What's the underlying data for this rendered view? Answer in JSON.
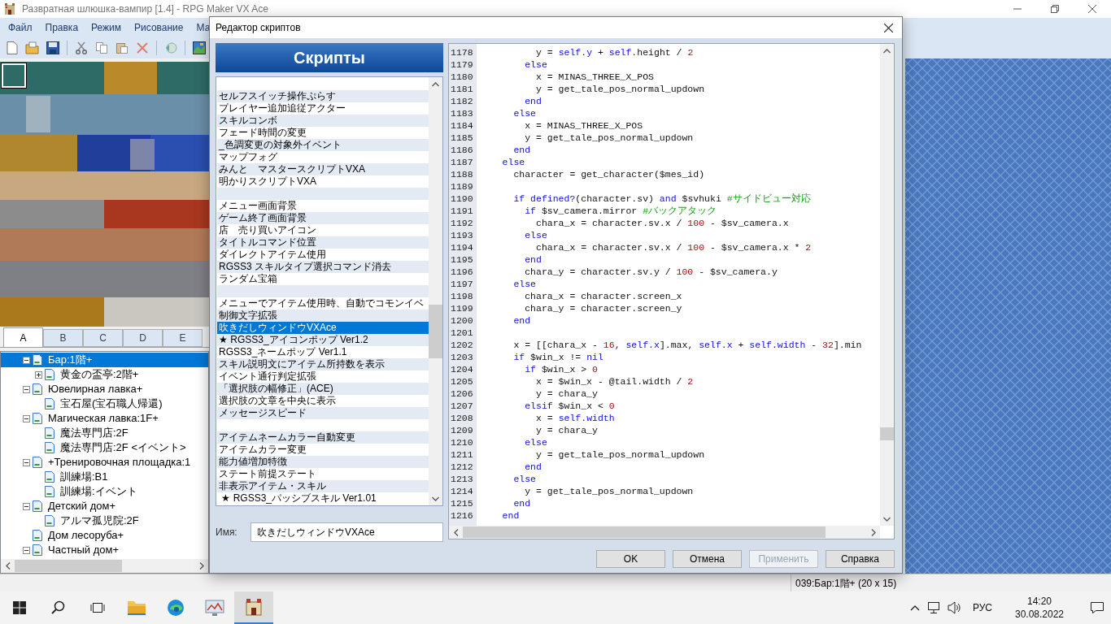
{
  "app": {
    "title": "Развратная шлюшка-вампир [1.4] - RPG Maker VX Ace"
  },
  "menu": [
    "Файл",
    "Правка",
    "Режим",
    "Рисование",
    "Ма"
  ],
  "tileset_tabs": [
    {
      "label": "A",
      "selected": true
    },
    {
      "label": "B",
      "selected": false
    },
    {
      "label": "C",
      "selected": false
    },
    {
      "label": "D",
      "selected": false
    },
    {
      "label": "E",
      "selected": false
    }
  ],
  "map_tree": [
    {
      "label": "Бар:1階+",
      "selected": true,
      "expanded": true,
      "children": [
        {
          "label": "黄金の盃亭:2階+",
          "selected": false,
          "expanded": false
        }
      ]
    },
    {
      "label": "Ювелирная лавка+",
      "selected": false,
      "expanded": true,
      "children": [
        {
          "label": "宝石屋(宝石職人帰還)",
          "selected": false
        }
      ]
    },
    {
      "label": "Магическая лавка:1F+",
      "selected": false,
      "expanded": true,
      "children": [
        {
          "label": "魔法専門店:2F",
          "selected": false
        },
        {
          "label": "魔法専門店:2F <イベント>",
          "selected": false
        }
      ]
    },
    {
      "label": "+Тренировочная площадка:1",
      "selected": false,
      "expanded": true,
      "children": [
        {
          "label": "訓練場:B1",
          "selected": false
        },
        {
          "label": "訓練場:イベント",
          "selected": false
        }
      ]
    },
    {
      "label": "Детский дом+",
      "selected": false,
      "expanded": true,
      "children": [
        {
          "label": "アルマ孤児院:2F",
          "selected": false
        }
      ]
    },
    {
      "label": "Дом лесоруба+",
      "selected": false
    },
    {
      "label": "Частный дом+",
      "selected": false,
      "expanded": true
    }
  ],
  "status_bar": {
    "map_info": "039:Бар:1階+ (20 x 15)"
  },
  "script_editor": {
    "title": "Редактор скриптов",
    "header": "Скрипты",
    "scripts": [
      {
        "kind": "blank",
        "selected": false
      },
      {
        "kind": "script",
        "label": "セルフスイッチ操作ぷらす",
        "selected": false
      },
      {
        "kind": "script",
        "label": "プレイヤー追加追従アクター",
        "selected": false
      },
      {
        "kind": "script",
        "label": "スキルコンボ",
        "selected": false
      },
      {
        "kind": "script",
        "label": "フェード時間の変更",
        "selected": false
      },
      {
        "kind": "script",
        "label": "_色調変更の対象外イベント",
        "selected": false
      },
      {
        "kind": "script",
        "label": "マップフォグ",
        "selected": false
      },
      {
        "kind": "script",
        "label": "みんと　マスタースクリプトVXA",
        "selected": false
      },
      {
        "kind": "script",
        "label": "明かりスクリプトVXA",
        "selected": false
      },
      {
        "kind": "blank",
        "selected": false
      },
      {
        "kind": "script",
        "label": "メニュー画面背景",
        "selected": false
      },
      {
        "kind": "script",
        "label": "ゲーム終了画面背景",
        "selected": false
      },
      {
        "kind": "script",
        "label": "店　売り買いアイコン",
        "selected": false
      },
      {
        "kind": "script",
        "label": "タイトルコマンド位置",
        "selected": false
      },
      {
        "kind": "script",
        "label": "ダイレクトアイテム使用",
        "selected": false
      },
      {
        "kind": "script",
        "label": "RGSS3 スキルタイプ選択コマンド消去",
        "selected": false
      },
      {
        "kind": "script",
        "label": "ランダム宝箱",
        "selected": false
      },
      {
        "kind": "blank",
        "selected": false
      },
      {
        "kind": "script",
        "label": "メニューでアイテム使用時、自動でコモンイベ",
        "selected": false
      },
      {
        "kind": "script",
        "label": "制御文字拡張",
        "selected": false
      },
      {
        "kind": "script",
        "label": "吹きだしウィンドウVXAce",
        "selected": true
      },
      {
        "kind": "script",
        "label": "★ RGSS3_アイコンポップ Ver1.2",
        "selected": false
      },
      {
        "kind": "script",
        "label": "RGSS3_ネームポップ Ver1.1",
        "selected": false
      },
      {
        "kind": "script",
        "label": "スキル説明文にアイテム所持数を表示",
        "selected": false
      },
      {
        "kind": "script",
        "label": "イベント通行判定拡張",
        "selected": false
      },
      {
        "kind": "script",
        "label": "「選択肢の幅修正」(ACE)",
        "selected": false
      },
      {
        "kind": "script",
        "label": "選択肢の文章を中央に表示",
        "selected": false
      },
      {
        "kind": "script",
        "label": "メッセージスピード",
        "selected": false
      },
      {
        "kind": "blank",
        "selected": false
      },
      {
        "kind": "script",
        "label": "アイテムネームカラー自動変更",
        "selected": false
      },
      {
        "kind": "script",
        "label": "アイテムカラー変更",
        "selected": false
      },
      {
        "kind": "script",
        "label": "能力値増加特徴",
        "selected": false
      },
      {
        "kind": "script",
        "label": "ステート前提ステート",
        "selected": false
      },
      {
        "kind": "script",
        "label": "非表示アイテム・スキル",
        "selected": false
      },
      {
        "kind": "script",
        "label": " ★ RGSS3_パッシブスキル Ver1.01",
        "selected": false
      }
    ],
    "name_label": "Имя:",
    "name_value": "吹きだしウィンドウVXAce",
    "code_lines": [
      {
        "number": "1178",
        "segments": [
          {
            "kind": "plain",
            "text": "          y = "
          },
          {
            "kind": "keyword",
            "text": "self.y"
          },
          {
            "kind": "plain",
            "text": " + "
          },
          {
            "kind": "keyword",
            "text": "self."
          },
          {
            "kind": "plain",
            "text": "height / "
          },
          {
            "kind": "number",
            "text": "2"
          }
        ]
      },
      {
        "number": "1179",
        "segments": [
          {
            "kind": "keyword",
            "text": "        else"
          }
        ]
      },
      {
        "number": "1180",
        "segments": [
          {
            "kind": "plain",
            "text": "          x = MINAS_THREE_X_POS"
          }
        ]
      },
      {
        "number": "1181",
        "segments": [
          {
            "kind": "plain",
            "text": "          y = get_tale_pos_normal_updown"
          }
        ]
      },
      {
        "number": "1182",
        "segments": [
          {
            "kind": "keyword",
            "text": "        end"
          }
        ]
      },
      {
        "number": "1183",
        "segments": [
          {
            "kind": "keyword",
            "text": "      else"
          }
        ]
      },
      {
        "number": "1184",
        "segments": [
          {
            "kind": "plain",
            "text": "        x = MINAS_THREE_X_POS"
          }
        ]
      },
      {
        "number": "1185",
        "segments": [
          {
            "kind": "plain",
            "text": "        y = get_tale_pos_normal_updown"
          }
        ]
      },
      {
        "number": "1186",
        "segments": [
          {
            "kind": "keyword",
            "text": "      end"
          }
        ]
      },
      {
        "number": "1187",
        "segments": [
          {
            "kind": "keyword",
            "text": "    else"
          }
        ]
      },
      {
        "number": "1188",
        "segments": [
          {
            "kind": "plain",
            "text": "      character = get_character($mes_id)"
          }
        ]
      },
      {
        "number": "1189"
      },
      {
        "number": "1190",
        "segments": [
          {
            "kind": "keyword",
            "text": "      if defined?"
          },
          {
            "kind": "plain",
            "text": "(character.sv) "
          },
          {
            "kind": "keyword",
            "text": "and"
          },
          {
            "kind": "plain",
            "text": " $svhuki "
          },
          {
            "kind": "comment",
            "text": "#サイドビュー対応"
          }
        ]
      },
      {
        "number": "1191",
        "segments": [
          {
            "kind": "keyword",
            "text": "        if"
          },
          {
            "kind": "plain",
            "text": " $sv_camera.mirror "
          },
          {
            "kind": "comment",
            "text": "#バックアタック"
          }
        ]
      },
      {
        "number": "1192",
        "segments": [
          {
            "kind": "plain",
            "text": "          chara_x = character.sv.x / "
          },
          {
            "kind": "number",
            "text": "100"
          },
          {
            "kind": "plain",
            "text": " - $sv_camera.x"
          }
        ]
      },
      {
        "number": "1193",
        "segments": [
          {
            "kind": "keyword",
            "text": "        else"
          }
        ]
      },
      {
        "number": "1194",
        "segments": [
          {
            "kind": "plain",
            "text": "          chara_x = character.sv.x / "
          },
          {
            "kind": "number",
            "text": "100"
          },
          {
            "kind": "plain",
            "text": " - $sv_camera.x * "
          },
          {
            "kind": "number",
            "text": "2"
          }
        ]
      },
      {
        "number": "1195",
        "segments": [
          {
            "kind": "keyword",
            "text": "        end"
          }
        ]
      },
      {
        "number": "1196",
        "segments": [
          {
            "kind": "plain",
            "text": "        chara_y = character.sv.y / "
          },
          {
            "kind": "number",
            "text": "100"
          },
          {
            "kind": "plain",
            "text": " - $sv_camera.y"
          }
        ]
      },
      {
        "number": "1197",
        "segments": [
          {
            "kind": "keyword",
            "text": "      else"
          }
        ]
      },
      {
        "number": "1198",
        "segments": [
          {
            "kind": "plain",
            "text": "        chara_x = character.screen_x"
          }
        ]
      },
      {
        "number": "1199",
        "segments": [
          {
            "kind": "plain",
            "text": "        chara_y = character.screen_y"
          }
        ]
      },
      {
        "number": "1200",
        "segments": [
          {
            "kind": "keyword",
            "text": "      end"
          }
        ]
      },
      {
        "number": "1201"
      },
      {
        "number": "1202",
        "segments": [
          {
            "kind": "plain",
            "text": "      x = [[chara_x - "
          },
          {
            "kind": "number",
            "text": "16"
          },
          {
            "kind": "plain",
            "text": ", "
          },
          {
            "kind": "keyword",
            "text": "self.x"
          },
          {
            "kind": "plain",
            "text": "].max, "
          },
          {
            "kind": "keyword",
            "text": "self.x"
          },
          {
            "kind": "plain",
            "text": " + "
          },
          {
            "kind": "keyword",
            "text": "self.width"
          },
          {
            "kind": "plain",
            "text": " - "
          },
          {
            "kind": "number",
            "text": "32"
          },
          {
            "kind": "plain",
            "text": "].min"
          }
        ]
      },
      {
        "number": "1203",
        "segments": [
          {
            "kind": "keyword",
            "text": "      if"
          },
          {
            "kind": "plain",
            "text": " $win_x != "
          },
          {
            "kind": "keyword",
            "text": "nil"
          }
        ]
      },
      {
        "number": "1204",
        "segments": [
          {
            "kind": "keyword",
            "text": "        if"
          },
          {
            "kind": "plain",
            "text": " $win_x > "
          },
          {
            "kind": "number",
            "text": "0"
          }
        ]
      },
      {
        "number": "1205",
        "segments": [
          {
            "kind": "plain",
            "text": "          x = $win_x - @tail.width / "
          },
          {
            "kind": "number",
            "text": "2"
          }
        ]
      },
      {
        "number": "1206",
        "segments": [
          {
            "kind": "plain",
            "text": "          y = chara_y"
          }
        ]
      },
      {
        "number": "1207",
        "segments": [
          {
            "kind": "keyword",
            "text": "        elsif"
          },
          {
            "kind": "plain",
            "text": " $win_x < "
          },
          {
            "kind": "number",
            "text": "0"
          }
        ]
      },
      {
        "number": "1208",
        "segments": [
          {
            "kind": "plain",
            "text": "          x = "
          },
          {
            "kind": "keyword",
            "text": "self.width"
          }
        ]
      },
      {
        "number": "1209",
        "segments": [
          {
            "kind": "plain",
            "text": "          y = chara_y"
          }
        ]
      },
      {
        "number": "1210",
        "segments": [
          {
            "kind": "keyword",
            "text": "        else"
          }
        ]
      },
      {
        "number": "1211",
        "segments": [
          {
            "kind": "plain",
            "text": "          y = get_tale_pos_normal_updown"
          }
        ]
      },
      {
        "number": "1212",
        "segments": [
          {
            "kind": "keyword",
            "text": "        end"
          }
        ]
      },
      {
        "number": "1213",
        "segments": [
          {
            "kind": "keyword",
            "text": "      else"
          }
        ]
      },
      {
        "number": "1214",
        "segments": [
          {
            "kind": "plain",
            "text": "        y = get_tale_pos_normal_updown"
          }
        ]
      },
      {
        "number": "1215",
        "segments": [
          {
            "kind": "keyword",
            "text": "      end"
          }
        ]
      },
      {
        "number": "1216",
        "segments": [
          {
            "kind": "keyword",
            "text": "    end"
          }
        ]
      }
    ],
    "buttons": [
      {
        "label": "OK",
        "disabled": false
      },
      {
        "label": "Отмена",
        "disabled": false
      },
      {
        "label": "Применить",
        "disabled": true
      },
      {
        "label": "Справка",
        "disabled": false
      }
    ]
  },
  "taskbar": {
    "language": "РУС",
    "time": "14:20",
    "date": "30.08.2022"
  }
}
